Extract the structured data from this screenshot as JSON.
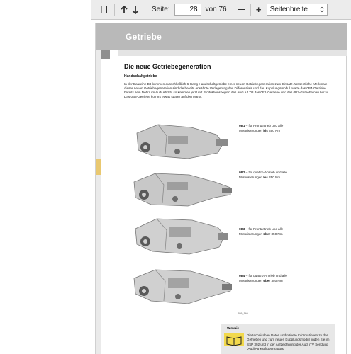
{
  "toolbar": {
    "page_label": "Seite:",
    "page_value": "28",
    "page_total": "von 76",
    "zoom_minus": "—",
    "zoom_plus": "+",
    "zoom_value": "Seitenbreite"
  },
  "page": {
    "chapter_title": "Getriebe",
    "heading": "Die neue Getriebegeneration",
    "subheading": "Handschaltgetriebe",
    "body": "In der Baureihe B8 kommen ausschließlich 6-Gang-Handschaltgetriebe einer neuen Getriebegeneration zum Einsatz. Wesentliche Merkmale dieser neuen Getriebegeneration sind die bereits erwähnte Verlagerung des Differenzials und das Kupplungsmodul. Hatte das 0B4-Getriebe bereits sein Debüt im Audi A5/S5, so kommen jetzt mit Produktionsbeginn des Audi A4 '08 das 0B1-Getriebe und das 0B2-Getriebe neu hinzu. Das 0B3-Getriebe kommt etwas später auf den Markt.",
    "gearboxes": [
      {
        "code": "0B1",
        "desc": " – für Frontantrieb und alle",
        "line2_pre": "Motorisierungen ",
        "line2_bold": "bis",
        "line2_post": " 350 Nm"
      },
      {
        "code": "0B2",
        "desc": " – für quattro-Antrieb und alle",
        "line2_pre": "Motorisierungen ",
        "line2_bold": "bis",
        "line2_post": " 350 Nm"
      },
      {
        "code": "0B3",
        "desc": " – für Frontantrieb und alle",
        "line2_pre": "Motorisierungen ",
        "line2_bold": "über",
        "line2_post": " 350 Nm"
      },
      {
        "code": "0B4",
        "desc": " – für quattro-Antrieb und alle",
        "line2_pre": "Motorisierungen ",
        "line2_bold": "über",
        "line2_post": " 350 Nm"
      }
    ],
    "figure_id": "409_140",
    "note_title": "Verweis",
    "note_text": "Die technischen Daten und nähere Informationen zu den Getrieben und zum neuen Kupplungsmodul finden Sie im SSP 392 und in der Aufzeichnung der Audi iTV Sendung „Audi A5 Kraftübertragung\"."
  },
  "icons": {
    "sidebar": "sidebar-toggle-icon",
    "up": "arrow-up-icon",
    "down": "arrow-down-icon",
    "select": "chevron-updown-icon"
  },
  "colors": {
    "toolbar_bg": "#ececec",
    "title_band": "#b9b9b9",
    "accent_yellow": "#e9c870",
    "note_bg": "#e7e7e7"
  }
}
